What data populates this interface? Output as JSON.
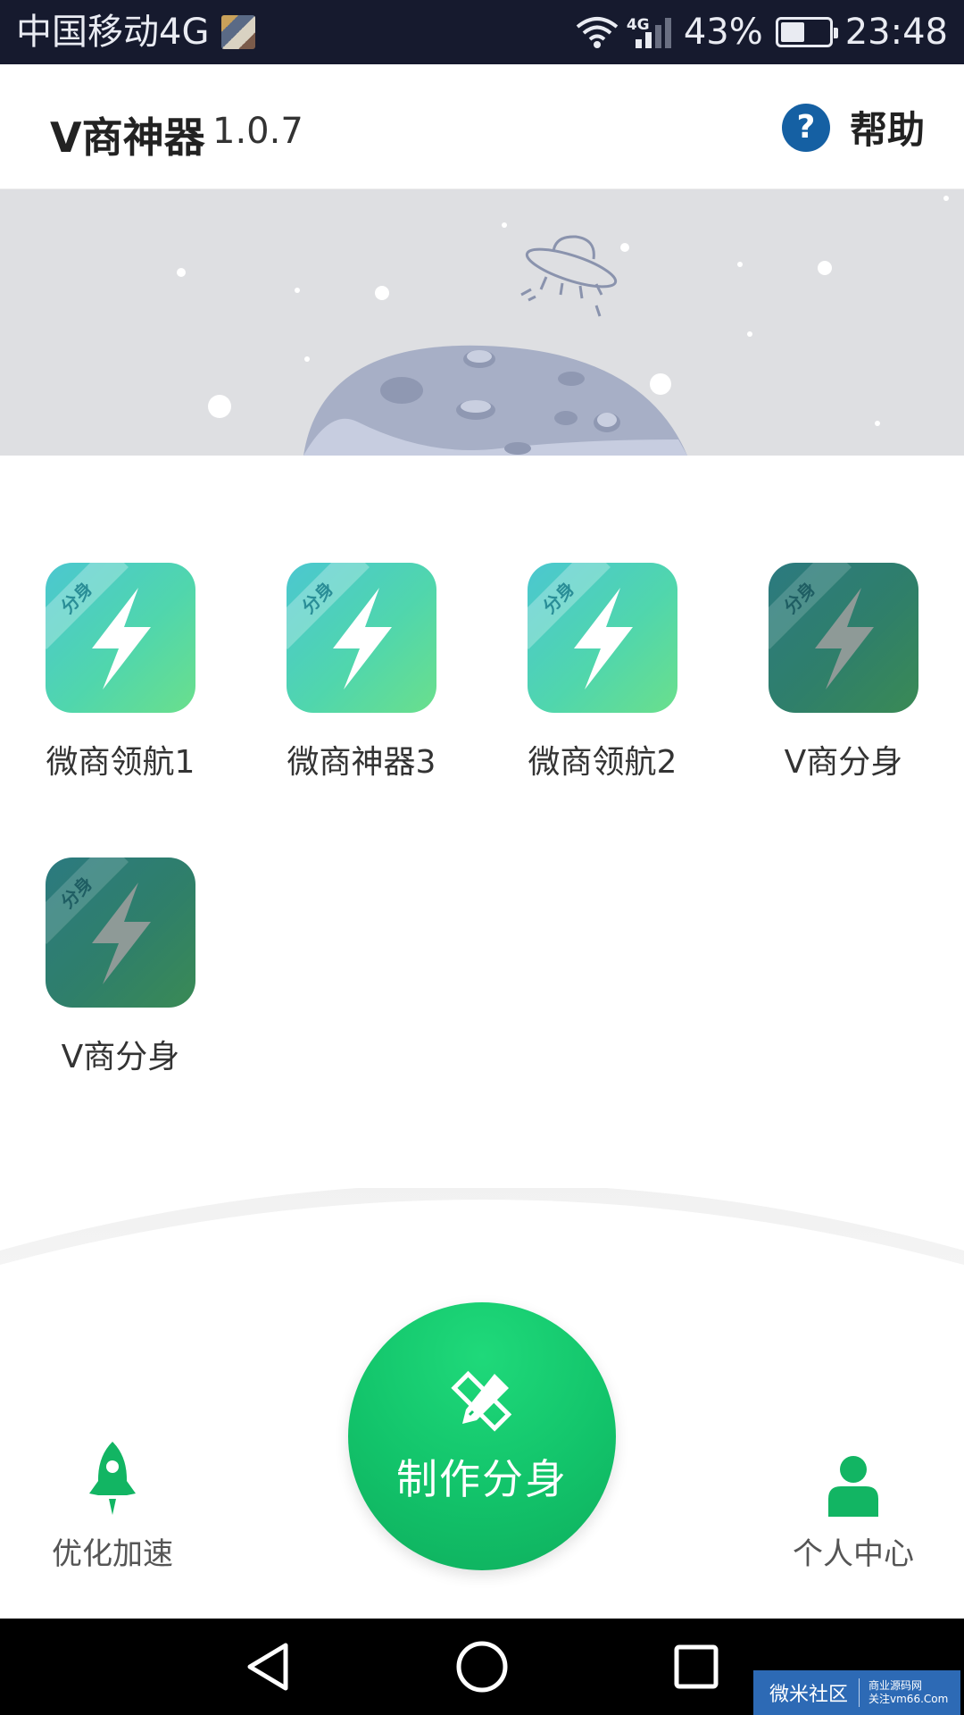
{
  "status_bar": {
    "carrier": "中国移动4G",
    "network_badge": "4G",
    "battery_percent": "43%",
    "time": "23:48",
    "icons": [
      "gallery-thumbnail-icon",
      "wifi-icon",
      "signal-icon",
      "battery-icon"
    ]
  },
  "header": {
    "title": "V商神器",
    "version": "1.0.7",
    "help_icon": "?",
    "help_label": "帮助"
  },
  "apps": [
    {
      "label": "微商领航1",
      "badge": "分身",
      "state": "active"
    },
    {
      "label": "微商神器3",
      "badge": "分身",
      "state": "active"
    },
    {
      "label": "微商领航2",
      "badge": "分身",
      "state": "active"
    },
    {
      "label": "V商分身",
      "badge": "分身",
      "state": "inactive"
    },
    {
      "label": "V商分身",
      "badge": "分身",
      "state": "inactive"
    }
  ],
  "bottom_nav": {
    "left_label": "优化加速",
    "center_label": "制作分身",
    "right_label": "个人中心"
  },
  "watermark": {
    "main": "微米社区",
    "line1": "商业源码网",
    "line2": "关注vm66.Com"
  },
  "colors": {
    "status_bar": "#161a2e",
    "brand_green": "#12c36a",
    "help_blue": "#1560a3",
    "banner_bg": "#dedfe2"
  }
}
